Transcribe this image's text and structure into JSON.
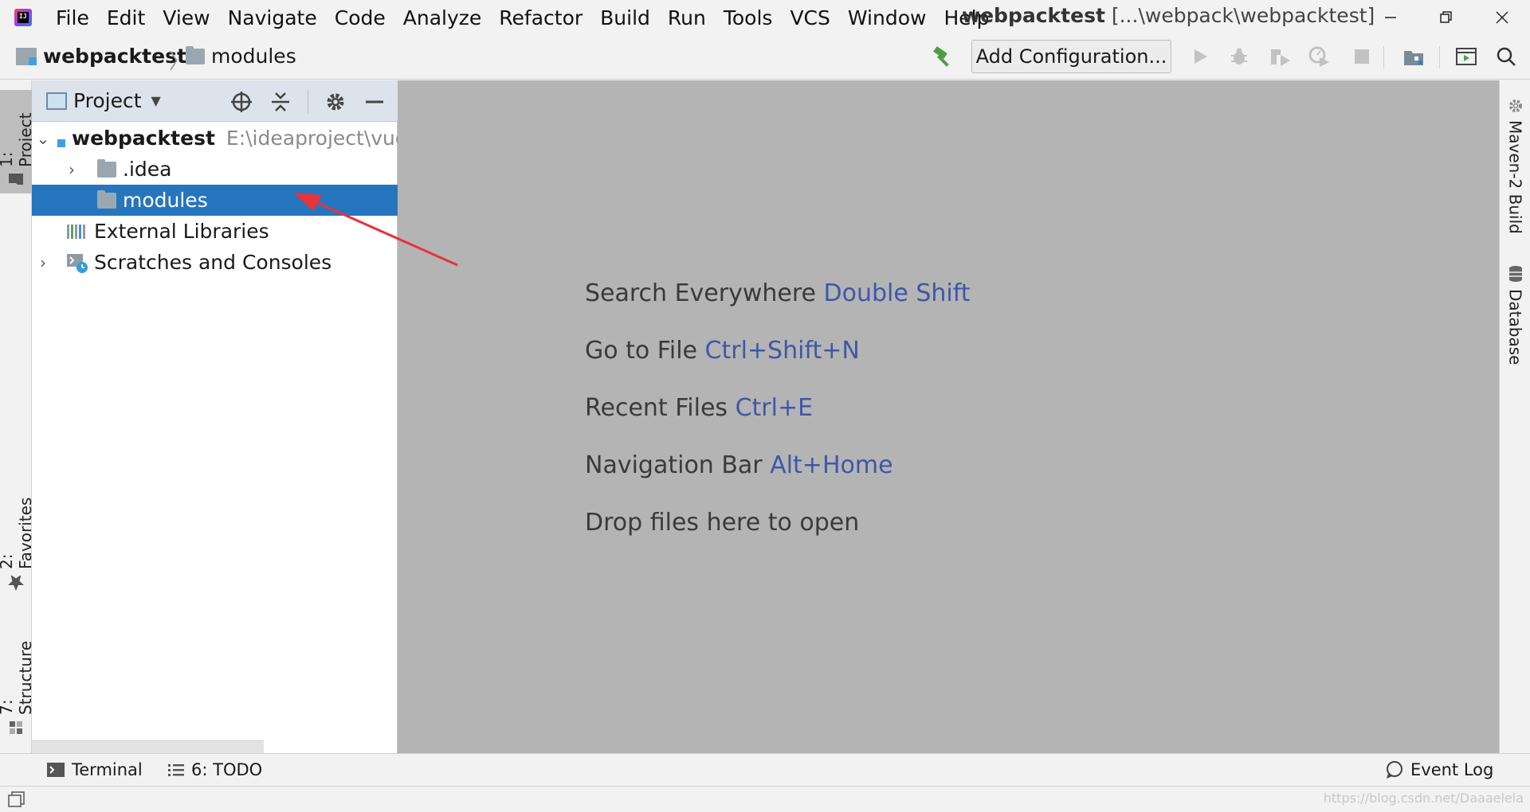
{
  "app": {
    "menu": [
      "File",
      "Edit",
      "View",
      "Navigate",
      "Code",
      "Analyze",
      "Refactor",
      "Build",
      "Run",
      "Tools",
      "VCS",
      "Window",
      "Help"
    ],
    "window_title_project": "webpacktest",
    "window_title_path": " [...\\webpack\\webpacktest]"
  },
  "navbar": {
    "project": "webpacktest",
    "folder": "modules",
    "add_configuration": "Add Configuration..."
  },
  "left_stripe": {
    "project": "1: Project",
    "favorites": "2: Favorites",
    "structure": "7: Structure"
  },
  "project_panel": {
    "title": "Project",
    "tree": [
      {
        "label": "webpacktest",
        "path": "E:\\ideaproject\\vue\\",
        "expanded": true,
        "selected": false
      },
      {
        "label": ".idea",
        "collapsed": true,
        "selected": false
      },
      {
        "label": "modules",
        "selected": true
      },
      {
        "label": "External Libraries",
        "selected": false
      },
      {
        "label": "Scratches and Consoles",
        "collapsed": true,
        "selected": false
      }
    ]
  },
  "editor": {
    "hints": [
      {
        "text": "Search Everywhere ",
        "key": "Double Shift"
      },
      {
        "text": "Go to File ",
        "key": "Ctrl+Shift+N"
      },
      {
        "text": "Recent Files ",
        "key": "Ctrl+E"
      },
      {
        "text": "Navigation Bar ",
        "key": "Alt+Home"
      },
      {
        "text": "Drop files here to open",
        "key": ""
      }
    ]
  },
  "right_stripe": {
    "maven": "Maven-2 Build",
    "database": "Database"
  },
  "bottom": {
    "terminal": "Terminal",
    "todo": "6: TODO",
    "event_log": "Event Log"
  },
  "watermark": "https://blog.csdn.net/Daaaelela",
  "colors": {
    "selection": "#2675bf",
    "shortcut_key": "#3f57a8",
    "annotation_arrow": "#e8333a",
    "editor_bg": "#b4b4b4"
  }
}
